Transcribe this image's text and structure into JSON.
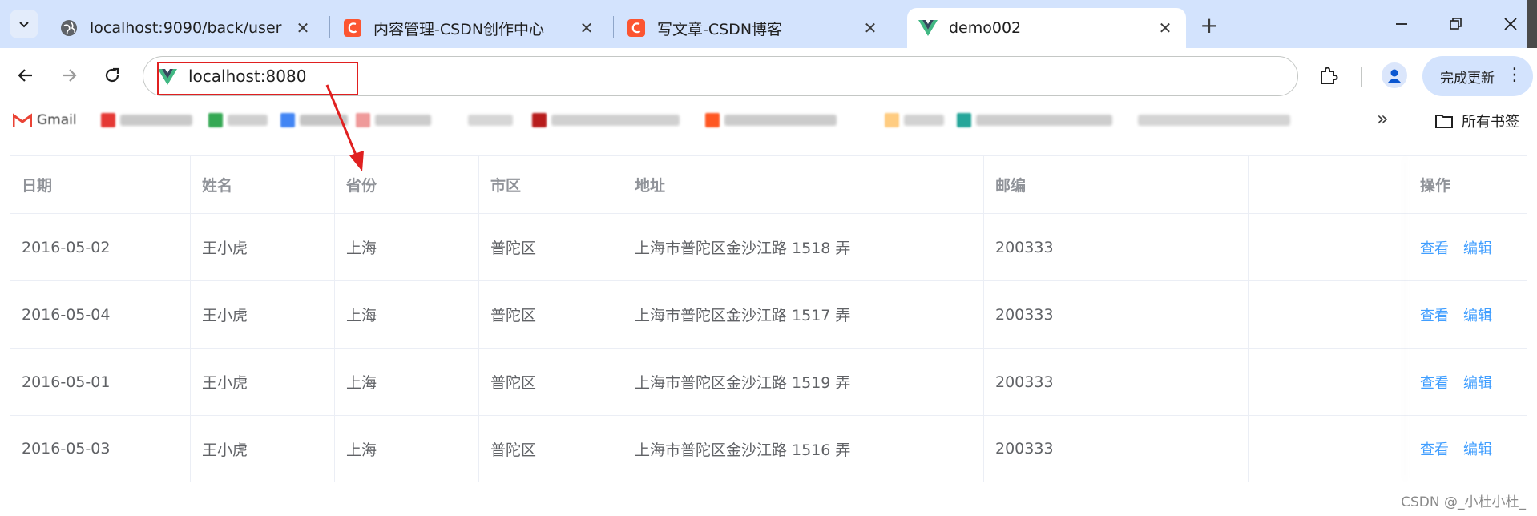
{
  "browser": {
    "tabs": [
      {
        "title": "localhost:9090/back/user",
        "icon": "globe-icon",
        "active": false
      },
      {
        "title": "内容管理-CSDN创作中心",
        "icon": "csdn-icon",
        "active": false
      },
      {
        "title": "写文章-CSDN博客",
        "icon": "csdn-icon",
        "active": false
      },
      {
        "title": "demo002",
        "icon": "vue-icon",
        "active": true
      }
    ],
    "new_tab": "+",
    "url": "localhost:8080",
    "update_label": "完成更新",
    "bookmarks_more": "»",
    "bookmarks_folder": "所有书签",
    "gmail_label": "Gmail",
    "accent": "#d3e3fd"
  },
  "table": {
    "headers": [
      "日期",
      "姓名",
      "省份",
      "市区",
      "地址",
      "邮编",
      "",
      "操作"
    ],
    "rows": [
      {
        "date": "2016-05-02",
        "name": "王小虎",
        "province": "上海",
        "city": "普陀区",
        "address": "上海市普陀区金沙江路 1518 弄",
        "zip": "200333"
      },
      {
        "date": "2016-05-04",
        "name": "王小虎",
        "province": "上海",
        "city": "普陀区",
        "address": "上海市普陀区金沙江路 1517 弄",
        "zip": "200333"
      },
      {
        "date": "2016-05-01",
        "name": "王小虎",
        "province": "上海",
        "city": "普陀区",
        "address": "上海市普陀区金沙江路 1519 弄",
        "zip": "200333"
      },
      {
        "date": "2016-05-03",
        "name": "王小虎",
        "province": "上海",
        "city": "普陀区",
        "address": "上海市普陀区金沙江路 1516 弄",
        "zip": "200333"
      }
    ],
    "actions": {
      "view": "查看",
      "edit": "编辑"
    },
    "link_color": "#409eff"
  },
  "watermark": "CSDN @_小杜小杜_"
}
